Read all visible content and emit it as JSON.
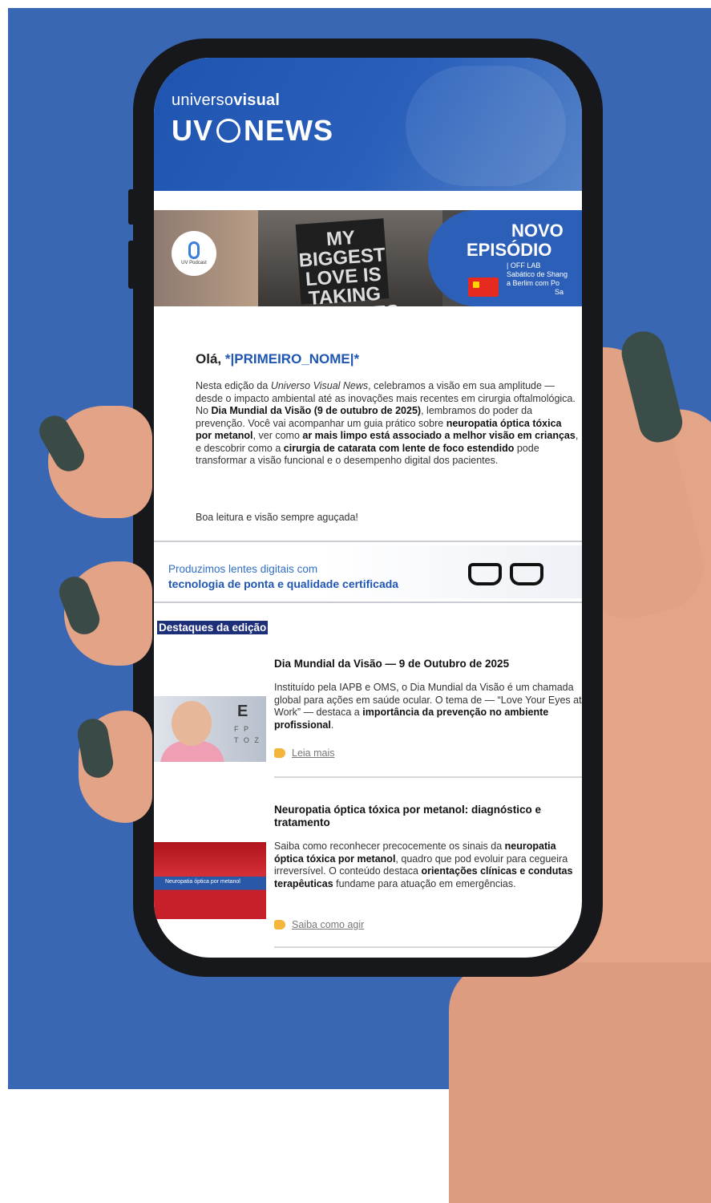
{
  "newsletter": {
    "brand": {
      "small_light": "universo",
      "small_bold": "visual",
      "big_left": "UV",
      "big_right": "NEWS"
    },
    "podcast_banner": {
      "badge_label": "UV Podcast",
      "sign_text": "MY BIGGEST LOVE IS TAKING PICTURES",
      "title_line1": "NOVO",
      "title_line2": "EPISÓDIO",
      "sub_line1": "| OFF LAB",
      "sub_line2": "Sabático de Shang",
      "sub_line3": "a Berlim com Po",
      "sub_line4": "Sa"
    },
    "greeting": {
      "hello": "Olá, ",
      "merge_tag": "*|PRIMEIRO_NOME|*"
    },
    "intro": {
      "p1": "Nesta edição da ",
      "p2": "Universo Visual News",
      "p3": ", celebramos a visão em sua amplitude — desde o impacto ambiental até as inovações mais recentes em cirurgia oftalmológica. No ",
      "p4": "Dia Mundial da Visão (9 de outubro de 2025)",
      "p5": ", lembramos do poder da prevenção. Você vai acompanhar um guia prático sobre ",
      "p6": "neuropatia óptica tóxica por metanol",
      "p7": ", ver como ",
      "p8": "ar mais limpo está associado a melhor visão em crianças",
      "p9": ", e descobrir como a ",
      "p10": "cirurgia de catarata com lente de foco estendido",
      "p11": " pode transformar a visão funcional e o desempenho digital dos pacientes."
    },
    "signoff": "Boa leitura e visão sempre aguçada!",
    "ad": {
      "line1": "Produzimos lentes digitais com",
      "line2": "tecnologia de ponta e qualidade certificada"
    },
    "highlights_title": "Destaques da edição",
    "articles": [
      {
        "title": "Dia Mundial da Visão — 9 de Outubro de 2025",
        "b1": "Instituído pela IAPB e OMS, o Dia Mundial da Visão é um chamada global para ações em saúde ocular. O tema de — “Love Your Eyes at Work” — destaca a ",
        "b2": "importância da prevenção no ambiente profissional",
        "b3": ".",
        "link": "Leia mais"
      },
      {
        "title": "Neuropatia óptica tóxica por metanol: diagnóstico e tratamento",
        "b1": "Saiba como reconhecer precocemente os sinais da ",
        "b2": "neuropatia óptica tóxica por metanol",
        "b3": ", quadro que pod evoluir para cegueira irreversível. O conteúdo destaca ",
        "b4": "orientações clínicas e condutas terapêuticas",
        "b5": " fundame para atuação em emergências.",
        "img_caption": "Neuropatia óptica por metanol",
        "link": "Saiba como agir"
      }
    ]
  },
  "colors": {
    "background_blue": "#3a67b4",
    "brand_blue": "#1f56b2",
    "highlight_bg": "#1e2f7a",
    "nail": "#3a4a46"
  }
}
